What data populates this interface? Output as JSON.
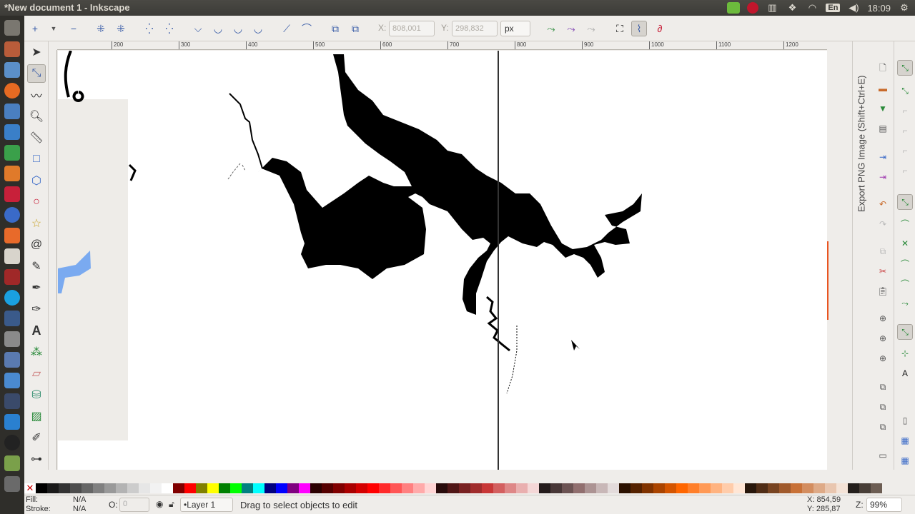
{
  "window": {
    "title": "*New document 1 - Inkscape"
  },
  "tray": {
    "language": "En",
    "time": "18:09"
  },
  "toolbar": {
    "x_label": "X:",
    "x_value": "808,001",
    "y_label": "Y:",
    "y_value": "298,832",
    "unit": "px"
  },
  "ruler": {
    "ticks": [
      {
        "label": "200"
      },
      {
        "label": "300"
      },
      {
        "label": "400"
      },
      {
        "label": "500"
      },
      {
        "label": "600"
      },
      {
        "label": "700"
      },
      {
        "label": "800"
      },
      {
        "label": "900"
      },
      {
        "label": "1000"
      },
      {
        "label": "1100"
      },
      {
        "label": "1200"
      }
    ]
  },
  "docker": {
    "tab_label": "Export PNG Image (Shift+Ctrl+E)"
  },
  "palette": {
    "colors": [
      "#000000",
      "#1a1a1a",
      "#333333",
      "#4d4d4d",
      "#666666",
      "#808080",
      "#999999",
      "#b3b3b3",
      "#cccccc",
      "#e6e6e6",
      "#f2f2f2",
      "#ffffff",
      "#800000",
      "#ff0000",
      "#808000",
      "#ffff00",
      "#008000",
      "#00ff00",
      "#008080",
      "#00ffff",
      "#000080",
      "#0000ff",
      "#800080",
      "#ff00ff",
      "#2b0000",
      "#550000",
      "#800000",
      "#aa0000",
      "#d40000",
      "#ff0000",
      "#ff2a2a",
      "#ff5555",
      "#ff8080",
      "#ffaaaa",
      "#ffd5d5",
      "#280b0b",
      "#501616",
      "#782121",
      "#a02c2c",
      "#c83737",
      "#d35f5f",
      "#de8787",
      "#e9afaf",
      "#f4d7d7",
      "#241c1c",
      "#483737",
      "#6c5353",
      "#916f6f",
      "#ac9393",
      "#c8b7b7",
      "#e3dbdb",
      "#2b1100",
      "#552200",
      "#803300",
      "#aa4400",
      "#d45500",
      "#ff6600",
      "#ff7f2a",
      "#ff9955",
      "#ffb380",
      "#ffccaa",
      "#ffe6d5",
      "#28170b",
      "#502d16",
      "#784421",
      "#a05a2c",
      "#c87137",
      "#d38d5f",
      "#deaa87",
      "#e9c6af",
      "#f4e3d7",
      "#241f1c",
      "#483e37",
      "#6c5d53"
    ]
  },
  "status": {
    "fill_label": "Fill:",
    "fill_value": "N/A",
    "stroke_label": "Stroke:",
    "stroke_value": "N/A",
    "opacity_label": "O:",
    "opacity_value": "0",
    "layer": "•Layer 1",
    "message": "Drag to select objects to edit",
    "cursor_x": "X: 854,59",
    "cursor_y": "Y: 285,87",
    "zoom_label": "Z:",
    "zoom_value": "99%"
  }
}
